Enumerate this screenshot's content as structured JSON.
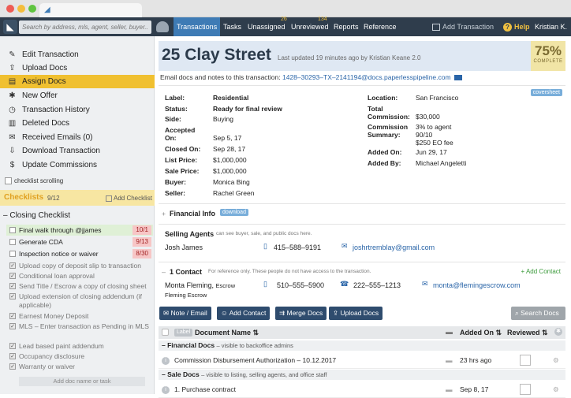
{
  "nav": {
    "search_placeholder": "Search by address, mls, agent, seller, buyer...",
    "items": [
      {
        "label": "Transactions",
        "badge": ""
      },
      {
        "label": "Tasks",
        "badge": ""
      },
      {
        "label": "Unassigned",
        "badge": "26"
      },
      {
        "label": "Unreviewed",
        "badge": "134"
      },
      {
        "label": "Reports",
        "badge": ""
      },
      {
        "label": "Reference",
        "badge": ""
      }
    ],
    "add_transaction": "Add Transaction",
    "help": "Help",
    "user": "Kristian K."
  },
  "sidebar": {
    "items": [
      {
        "label": "Edit Transaction",
        "icon": "edit-icon"
      },
      {
        "label": "Upload Docs",
        "icon": "upload-icon"
      },
      {
        "label": "Assign Docs",
        "icon": "assign-icon"
      },
      {
        "label": "New Offer",
        "icon": "offer-icon"
      },
      {
        "label": "Transaction History",
        "icon": "history-icon"
      },
      {
        "label": "Deleted Docs",
        "icon": "trash-icon"
      },
      {
        "label": "Received Emails (0)",
        "icon": "mail-icon"
      },
      {
        "label": "Download Transaction",
        "icon": "download-icon"
      },
      {
        "label": "Update Commissions",
        "icon": "dollar-icon"
      }
    ],
    "checklist_scrolling": "checklist scrolling",
    "checklists_title": "Checklists",
    "checklists_count": "9/12",
    "add_checklist": "Add Checklist",
    "closing_checklist": "Closing Checklist",
    "open_items": [
      {
        "label": "Final walk through @jjames",
        "count": "10/1",
        "highlight": true
      },
      {
        "label": "Generate CDA",
        "count": "9/13",
        "highlight": false
      },
      {
        "label": "Inspection notice or waiver",
        "count": "8/30",
        "highlight": false
      }
    ],
    "done_items": [
      "Upload copy of deposit slip to transaction",
      "Conditional loan approval",
      "Send Title / Escrow a copy of closing sheet",
      "Upload extension of closing addendum (if applicable)",
      "Earnest Money Deposit",
      "MLS – Enter transaction as Pending in MLS",
      "Lead based paint addendum",
      "Occupancy disclosure",
      "Warranty or waiver"
    ],
    "add_doc": "Add doc name or task"
  },
  "header": {
    "title": "25 Clay Street",
    "last_updated": "Last updated 19 minutes ago by Kristian Keane 2.0",
    "percent": "75%",
    "percent_label": "COMPLETE",
    "email_prefix": "Email docs and notes to this transaction:",
    "email": "1428–30293–TX–2141194@docs.paperlesspipeline.com"
  },
  "details": {
    "coversheet": "coversheet",
    "label_k": "Label:",
    "label_v": "Residential",
    "status_k": "Status:",
    "status_v": "Ready for final review",
    "side_k": "Side:",
    "side_v": "Buying",
    "accepted_k": "Accepted On:",
    "accepted_v": "Sep 5, 17",
    "closed_k": "Closed On:",
    "closed_v": "Sep 28, 17",
    "list_k": "List Price:",
    "list_v": "$1,000,000",
    "sale_k": "Sale Price:",
    "sale_v": "$1,000,000",
    "buyer_k": "Buyer:",
    "buyer_v": "Monica Bing",
    "seller_k": "Seller:",
    "seller_v": "Rachel Green",
    "location_k": "Location:",
    "location_v": "San Francisco",
    "totalcomm_k": "Total Commission:",
    "totalcomm_v": "$30,000",
    "commsum_k": "Commission Summary:",
    "commsum_v1": "3% to agent",
    "commsum_v2": "90/10",
    "commsum_v3": "$250 EO fee",
    "added_on_k": "Added On:",
    "added_on_v": "Jun 29, 17",
    "added_by_k": "Added By:",
    "added_by_v": "Michael Angeletti"
  },
  "financial": {
    "title": "Financial Info",
    "download": "download"
  },
  "selling_agents": {
    "title": "Selling Agents",
    "note": "can see buyer, sale, and public docs here.",
    "name": "Josh James",
    "phone": "415–588–9191",
    "email": "joshrtremblay@gmail.com"
  },
  "contacts": {
    "title": "1 Contact",
    "note": "For reference only. These people do not have access to the transaction.",
    "add": "+ Add Contact",
    "name": "Monta Fleming,",
    "role": "Escrow",
    "company": "Fleming Escrow",
    "phone1": "510–555–5900",
    "phone2": "222–555–1213",
    "email": "monta@flemingescrow.com"
  },
  "actions": {
    "note_email": "Note / Email",
    "add_contact": "Add Contact",
    "merge_docs": "Merge Docs",
    "upload_docs": "Upload Docs",
    "search_docs": "Search Docs"
  },
  "table": {
    "label_tag": "Label",
    "col_name": "Document Name",
    "col_added": "Added On",
    "col_reviewed": "Reviewed",
    "groups": [
      {
        "title": "Financial Docs",
        "note": "– visible to backoffice admins",
        "rows": [
          {
            "name": "Commission Disbursement Authorization – 10.12.2017",
            "added": "23 hrs ago"
          }
        ]
      },
      {
        "title": "Sale Docs",
        "note": "– visible to listing, selling agents, and office staff",
        "rows": [
          {
            "name": "1. Purchase contract",
            "added": "Sep 8, 17"
          }
        ]
      }
    ]
  }
}
